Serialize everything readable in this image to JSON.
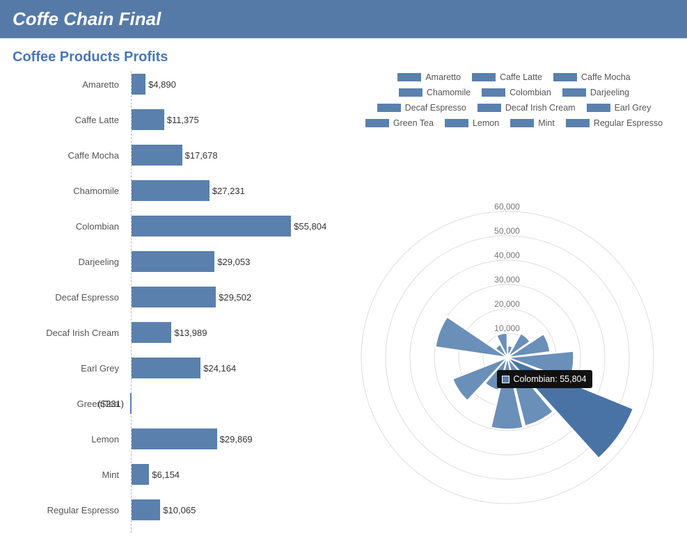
{
  "header": {
    "title": "Coffe Chain Final"
  },
  "subtitle": "Coffee Products Profits",
  "chart_data": [
    {
      "type": "bar",
      "title": "Coffee Products Profits",
      "categories": [
        "Amaretto",
        "Caffe Latte",
        "Caffe Mocha",
        "Chamomile",
        "Colombian",
        "Darjeeling",
        "Decaf Espresso",
        "Decaf Irish Cream",
        "Earl Grey",
        "Green Tea",
        "Lemon",
        "Mint",
        "Regular Espresso"
      ],
      "values": [
        4890,
        11375,
        17678,
        27231,
        55804,
        29053,
        29502,
        13989,
        24164,
        -231,
        29869,
        6154,
        10065
      ],
      "value_labels": [
        "$4,890",
        "$11,375",
        "$17,678",
        "$27,231",
        "$55,804",
        "$29,053",
        "$29,502",
        "$13,989",
        "$24,164",
        "($231)",
        "$29,869",
        "$6,154",
        "$10,065"
      ],
      "xlim": [
        -300,
        56000
      ]
    },
    {
      "type": "polar",
      "categories": [
        "Amaretto",
        "Caffe Latte",
        "Caffe Mocha",
        "Chamomile",
        "Colombian",
        "Darjeeling",
        "Decaf Espresso",
        "Decaf Irish Cream",
        "Earl Grey",
        "Green Tea",
        "Lemon",
        "Mint",
        "Regular Espresso"
      ],
      "values": [
        4890,
        11375,
        17678,
        27231,
        55804,
        29053,
        29502,
        13989,
        24164,
        -231,
        29869,
        6154,
        10065
      ],
      "ring_ticks": [
        10000,
        20000,
        30000,
        40000,
        50000,
        60000
      ],
      "ring_tick_labels": [
        "10,000",
        "20,000",
        "30,000",
        "40,000",
        "50,000",
        "60,000"
      ],
      "rlim": [
        0,
        60000
      ]
    }
  ],
  "legend": {
    "items": [
      "Amaretto",
      "Caffe Latte",
      "Caffe Mocha",
      "Chamomile",
      "Colombian",
      "Darjeeling",
      "Decaf Espresso",
      "Decaf Irish Cream",
      "Earl Grey",
      "Green Tea",
      "Lemon",
      "Mint",
      "Regular Espresso"
    ]
  },
  "tooltip": {
    "text": "Colombian: 55,804"
  },
  "colors": {
    "bar": "#5a80ad",
    "header_bg": "#567aa8",
    "link": "#4a77b4"
  }
}
